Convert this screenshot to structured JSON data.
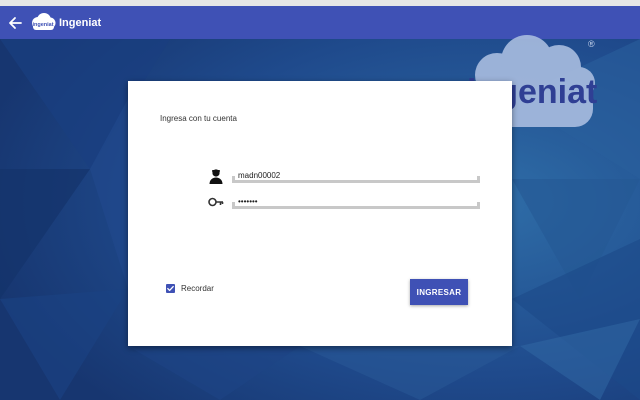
{
  "appbar": {
    "title": "Ingeniat",
    "logo_text": "ingeniat",
    "back_icon": "arrow-left-icon"
  },
  "brand": {
    "logo_text": "ingeniat",
    "registered_mark": "®"
  },
  "login": {
    "title": "Ingresa con tu cuenta",
    "username_value": "madn00002",
    "password_value": "•••••••",
    "user_icon": "user-icon",
    "password_icon": "key-icon",
    "remember_label": "Recordar",
    "remember_checked": true,
    "submit_label": "INGRESAR"
  },
  "colors": {
    "primary": "#3f51b5",
    "background": "#1d3d78",
    "card": "#ffffff"
  }
}
